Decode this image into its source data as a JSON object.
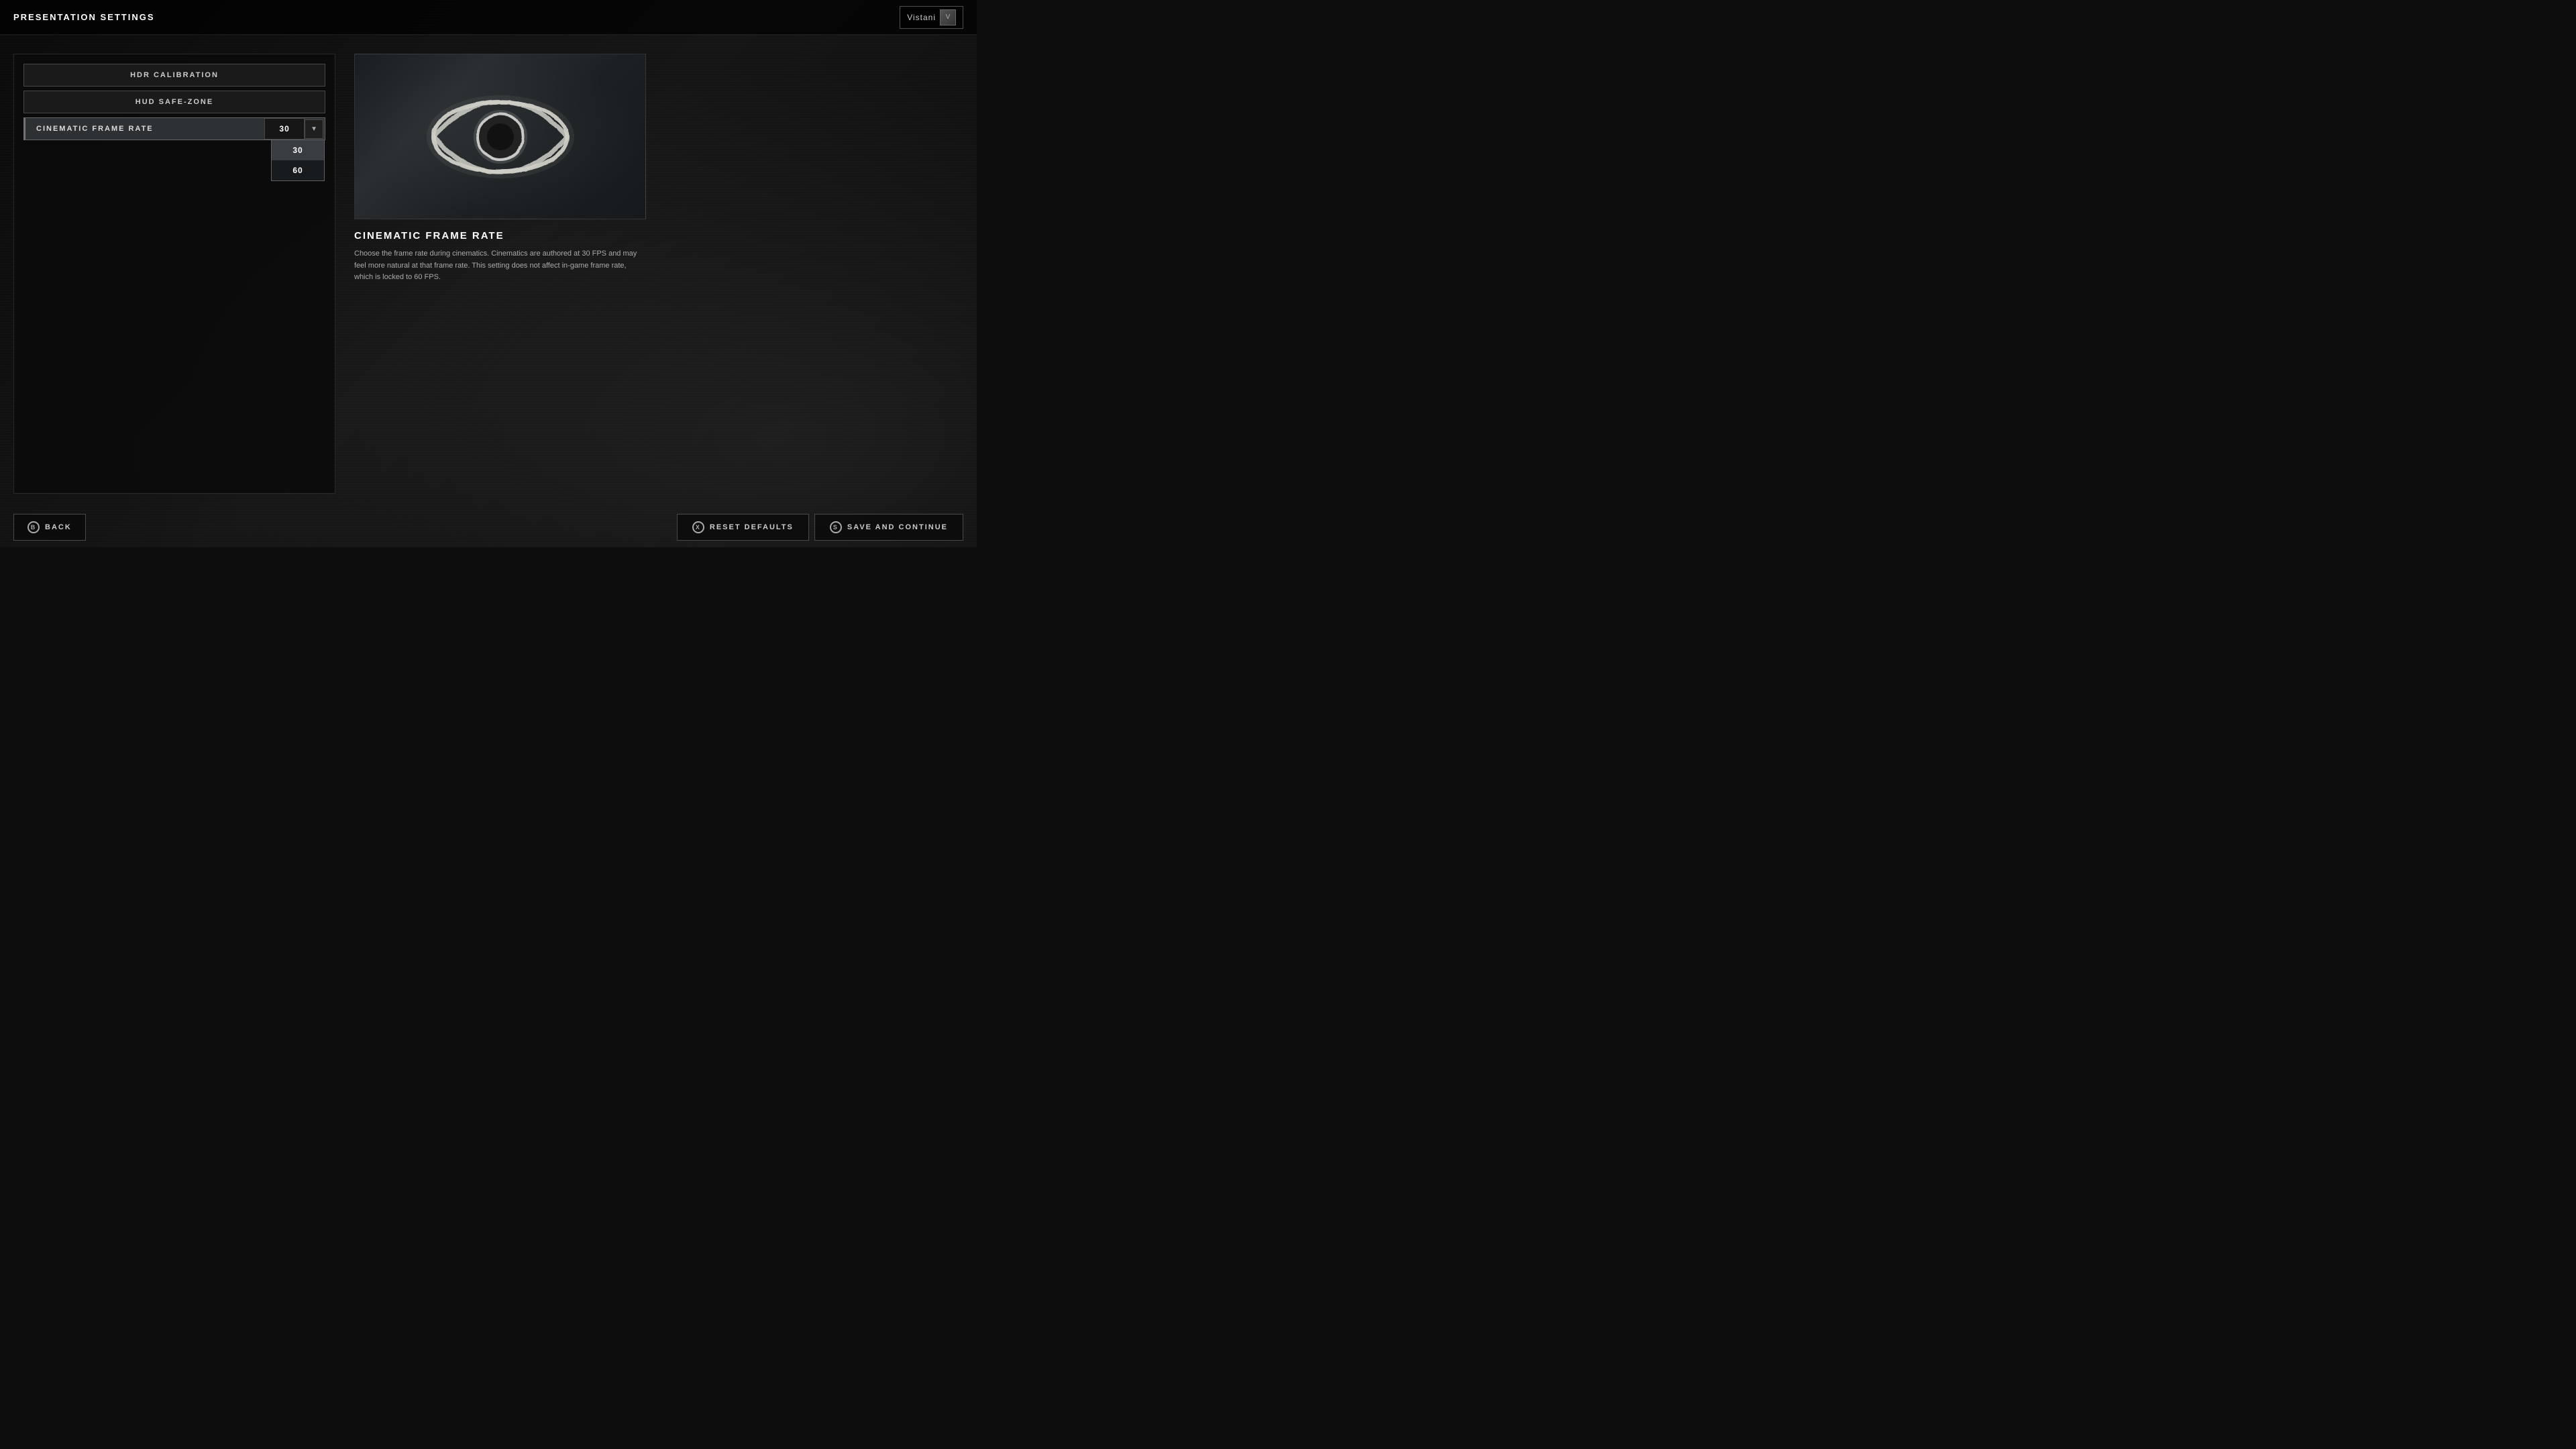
{
  "header": {
    "title": "PRESENTATION SETTINGS",
    "user": {
      "name": "Vistani",
      "avatar_label": "V"
    }
  },
  "left_panel": {
    "buttons": [
      {
        "id": "hdr-calibration",
        "label": "HDR CALIBRATION"
      },
      {
        "id": "hud-safe-zone",
        "label": "HUD SAFE-ZONE"
      }
    ],
    "active_setting": {
      "label": "CINEMATIC FRAME RATE",
      "current_value": "30",
      "dropdown_open": true,
      "options": [
        {
          "value": "30",
          "selected": true
        },
        {
          "value": "60",
          "selected": false
        }
      ]
    }
  },
  "right_panel": {
    "preview_alt": "Eye icon preview",
    "info": {
      "title": "CINEMATIC FRAME RATE",
      "description": "Choose the frame rate during cinematics. Cinematics are authored at 30 FPS and may feel more natural at that frame rate. This setting does not affect in-game frame rate, which is locked to 60 FPS."
    }
  },
  "bottom_bar": {
    "back_button": "BACK",
    "back_icon": "B",
    "reset_button": "RESET DEFAULTS",
    "reset_icon": "X",
    "save_button": "SAVE AND CONTINUE",
    "save_icon": "S"
  }
}
